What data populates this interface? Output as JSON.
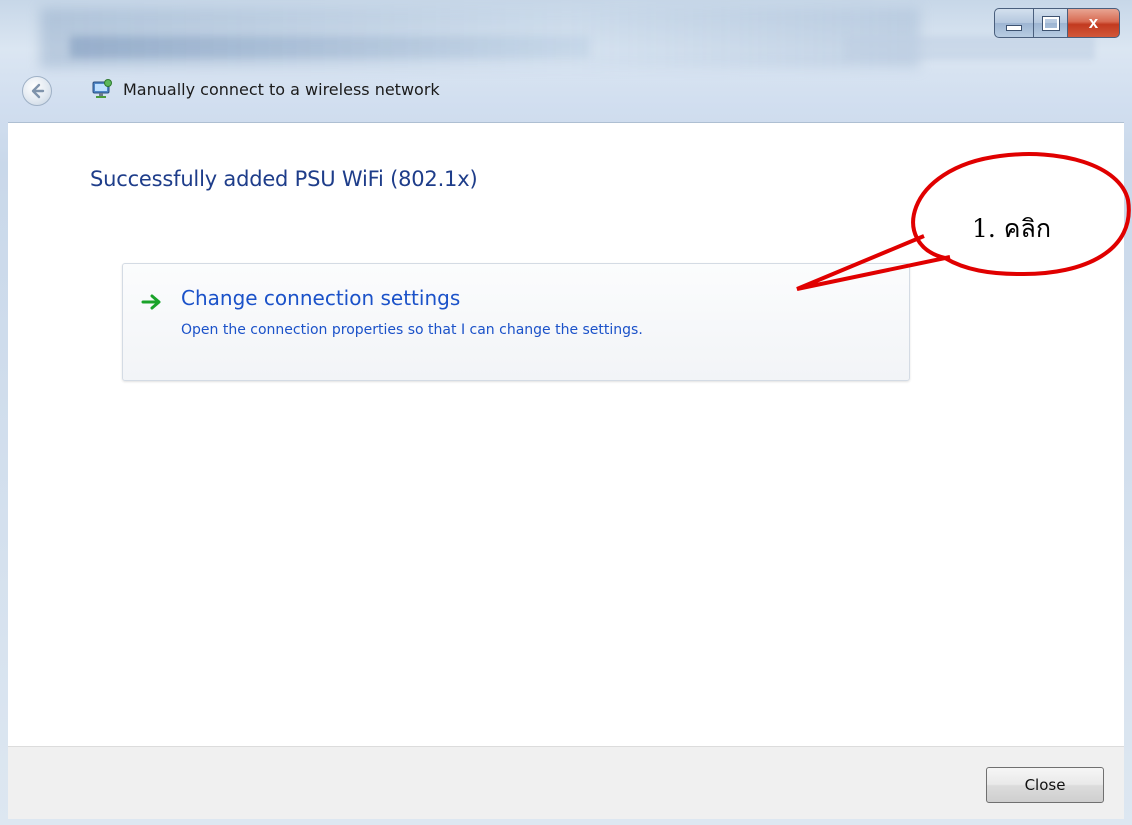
{
  "window": {
    "header_title": "Manually connect to a wireless network",
    "close_glyph": "x"
  },
  "content": {
    "success_title": "Successfully added PSU WiFi (802.1x)",
    "command_link": {
      "icon": "green-arrow-icon",
      "title": "Change connection settings",
      "description": "Open the connection properties so that I can change the settings."
    }
  },
  "footer": {
    "close_label": "Close"
  },
  "annotation": {
    "label": "1. คลิก",
    "color": "#e00000"
  },
  "colors": {
    "title_blue": "#1e3d8a",
    "link_blue": "#1b52c9",
    "arrow_green": "#1aa32a"
  }
}
